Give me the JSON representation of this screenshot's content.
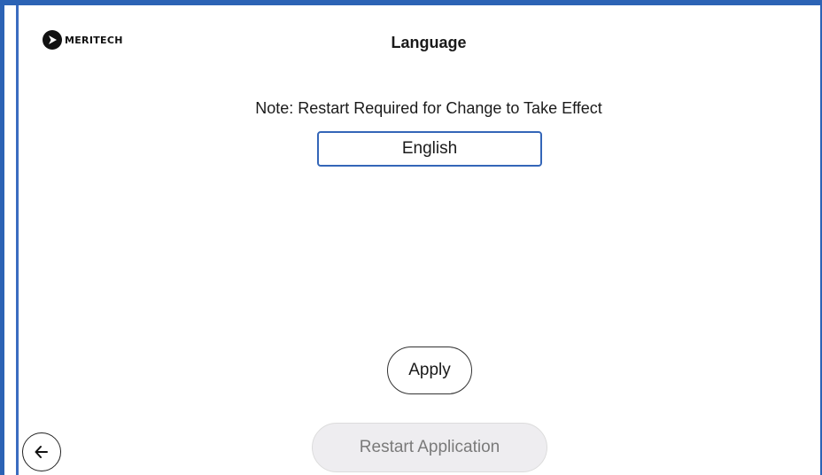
{
  "brand": {
    "logo_text": "MERITECH",
    "logo_icon": "meritech-logo-icon"
  },
  "header": {
    "title": "Language"
  },
  "main": {
    "note": "Note: Restart Required for Change to Take Effect",
    "language_select": {
      "value": "English"
    },
    "apply_label": "Apply",
    "restart_label": "Restart Application",
    "restart_disabled": true
  },
  "nav": {
    "back_icon": "arrow-left-icon"
  },
  "colors": {
    "accent": "#2c63b5",
    "disabled_bg": "#eeedf0",
    "disabled_text": "#7a7a7a"
  }
}
